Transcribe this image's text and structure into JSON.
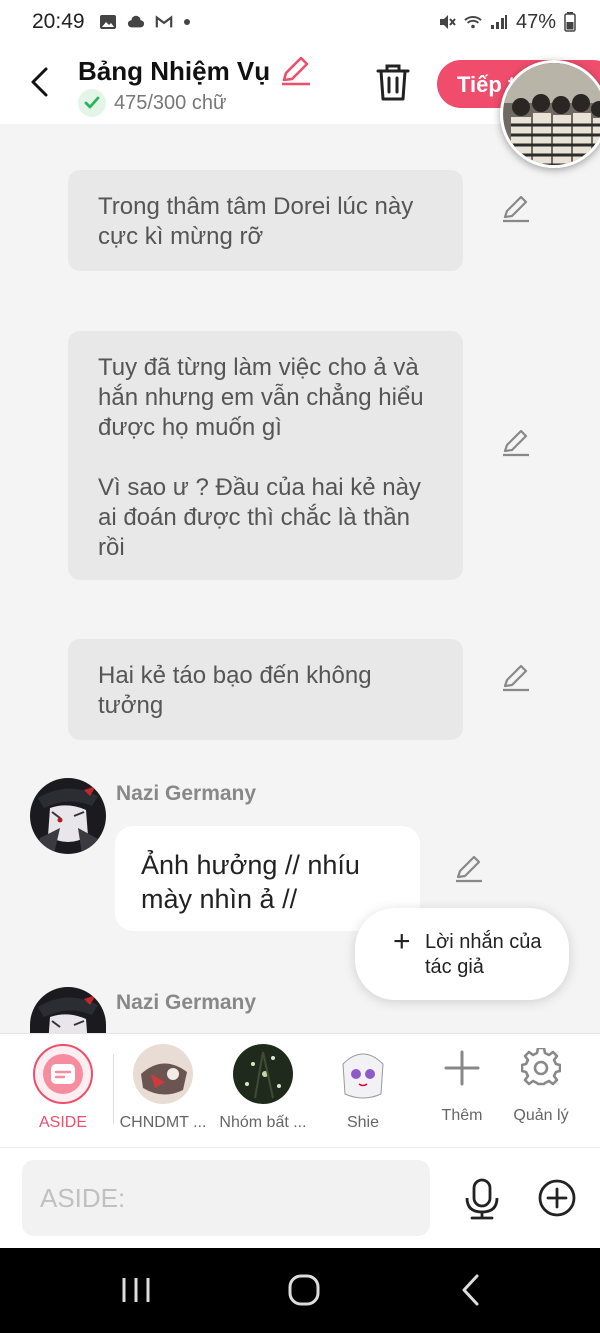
{
  "status_bar": {
    "time": "20:49",
    "battery": "47%"
  },
  "header": {
    "title": "Bảng Nhiệm Vụ",
    "word_count": "475/300 chữ",
    "next_label": "Tiếp t"
  },
  "messages": [
    {
      "type": "narration",
      "paragraphs": [
        "Trong thâm tâm Dorei lúc này cực kì mừng rỡ"
      ]
    },
    {
      "type": "narration",
      "paragraphs": [
        "Tuy đã từng làm việc cho ả và hắn nhưng em vẫn chẳng hiểu được họ muốn gì",
        "Vì sao ư ? Đầu của hai kẻ này ai đoán được thì chắc là thần rồi"
      ]
    },
    {
      "type": "narration",
      "paragraphs": [
        "Hai kẻ táo bạo đến không tưởng"
      ]
    },
    {
      "type": "character",
      "speaker": "Nazi Germany",
      "text": "Ảnh hưởng // nhíu mày nhìn ả //"
    },
    {
      "type": "character",
      "speaker": "Nazi Germany"
    }
  ],
  "author_note": {
    "label": "Lời nhắn của tác giả"
  },
  "character_bar": {
    "items": [
      {
        "label": "ASIDE",
        "selected": true
      },
      {
        "label": "CHNDMT ..."
      },
      {
        "label": "Nhóm bất ..."
      },
      {
        "label": "Shie"
      },
      {
        "label": "Thêm"
      },
      {
        "label": "Quản lý"
      }
    ]
  },
  "input": {
    "placeholder": "ASIDE:"
  },
  "colors": {
    "accent": "#ef4d6b",
    "check_green": "#2bb35a"
  }
}
